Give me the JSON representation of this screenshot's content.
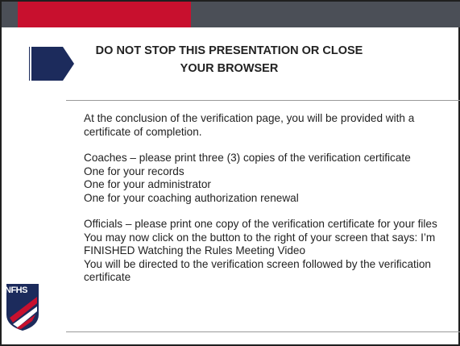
{
  "slide": {
    "title": "DO NOT STOP THIS PRESENTATION OR CLOSE YOUR BROWSER",
    "paragraph1": "At the conclusion of the verification page, you will be provided with a certificate of completion.",
    "coaches_line": "Coaches – please print three (3) copies of the verification certificate",
    "coaches_items": [
      "One for your records",
      "One for your administrator",
      "One for your coaching authorization renewal"
    ],
    "officials_line": "Officials – please print one copy of the verification certificate for your files",
    "click_line": "You may now click on the button to the right of your screen that says: I’m FINISHED Watching the Rules Meeting Video",
    "directed_line": "You will be directed to the verification screen followed by the verification certificate"
  },
  "logo": {
    "text": "NFHS"
  },
  "colors": {
    "accent_red": "#c8102e",
    "header_gray": "#4b4f57",
    "flag_navy": "#1c2b5c"
  }
}
